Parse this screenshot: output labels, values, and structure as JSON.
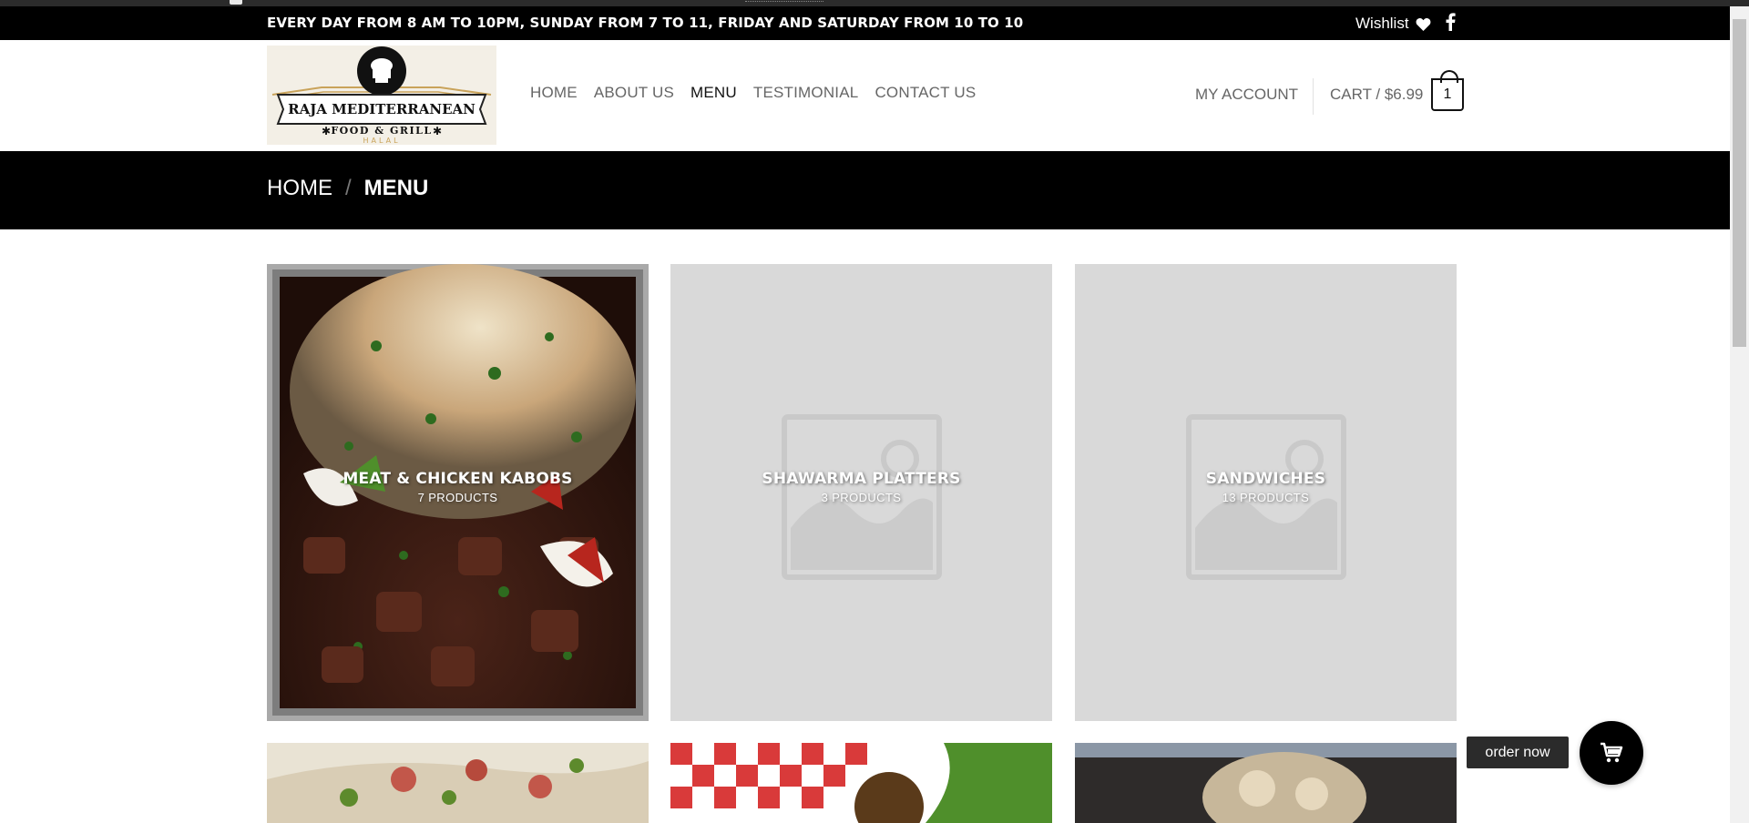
{
  "topbar": {
    "hours": "EVERY DAY FROM 8 AM TO 10PM, SUNDAY FROM 7 TO 11, FRIDAY AND SATURDAY FROM 10 TO 10",
    "wishlist": "Wishlist",
    "wishlist_icon": "heart-icon",
    "social_icon": "facebook-icon"
  },
  "logo": {
    "name": "RAJA MEDITERRANEAN",
    "tagline": "FOOD & GRILL",
    "sub": "HALAL"
  },
  "nav": {
    "items": [
      "HOME",
      "ABOUT US",
      "MENU",
      "TESTIMONIAL",
      "CONTACT US"
    ],
    "active": "MENU"
  },
  "account": {
    "label": "MY ACCOUNT"
  },
  "cart": {
    "label": "CART / $6.99",
    "count": "1"
  },
  "breadcrumb": {
    "home": "HOME",
    "separator": "/",
    "current": "MENU"
  },
  "categories": [
    {
      "title": "MEAT & CHICKEN KABOBS",
      "count": "7 PRODUCTS",
      "image": "photo"
    },
    {
      "title": "SHAWARMA PLATTERS",
      "count": "3 PRODUCTS",
      "image": "placeholder"
    },
    {
      "title": "SANDWICHES",
      "count": "13 PRODUCTS",
      "image": "placeholder"
    }
  ],
  "order_now": {
    "label": "order now",
    "icon": "cart-icon"
  },
  "colors": {
    "accent": "#000000",
    "placeholder_bg": "#d9d9d9",
    "nav_text": "#666666"
  }
}
